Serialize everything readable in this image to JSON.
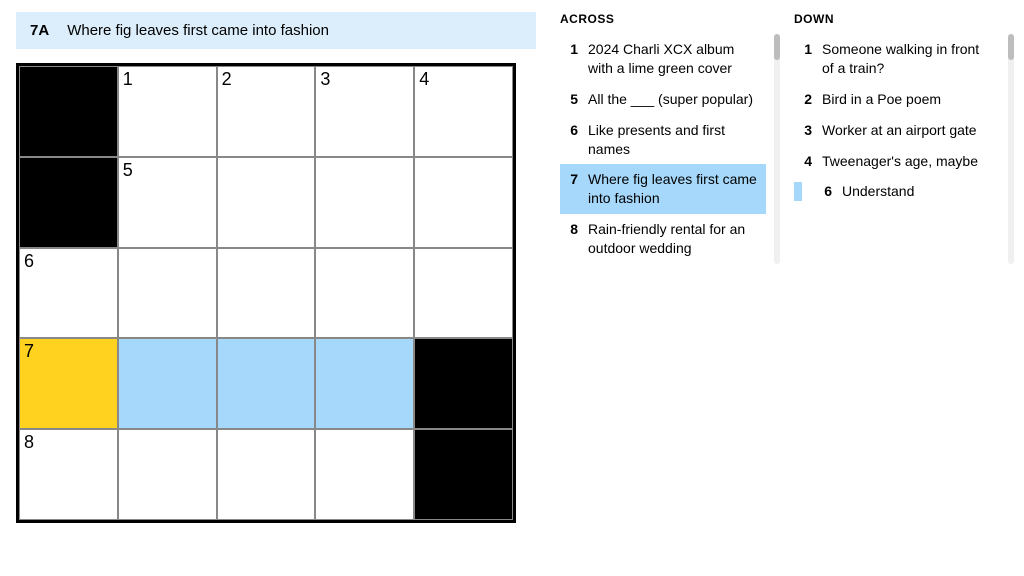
{
  "current_clue": {
    "label": "7A",
    "text": "Where fig leaves first came into fashion"
  },
  "grid": {
    "cols": 5,
    "rows": 5,
    "cells": [
      {
        "black": true
      },
      {
        "num": "1"
      },
      {
        "num": "2"
      },
      {
        "num": "3"
      },
      {
        "num": "4"
      },
      {
        "black": true
      },
      {
        "num": "5"
      },
      {},
      {},
      {},
      {
        "num": "6"
      },
      {},
      {},
      {},
      {},
      {
        "num": "7",
        "state": "active"
      },
      {
        "state": "highlight"
      },
      {
        "state": "highlight"
      },
      {
        "state": "highlight"
      },
      {
        "black": true
      },
      {
        "num": "8"
      },
      {},
      {},
      {},
      {
        "black": true
      }
    ]
  },
  "across": {
    "heading": "ACROSS",
    "clues": [
      {
        "num": "1",
        "text": "2024 Charli XCX album with a lime green cover"
      },
      {
        "num": "5",
        "text": "All the ___ (super popular)"
      },
      {
        "num": "6",
        "text": "Like presents and first names"
      },
      {
        "num": "7",
        "text": "Where fig leaves first came into fashion",
        "selected": true
      },
      {
        "num": "8",
        "text": "Rain-friendly rental for an outdoor wedding"
      }
    ]
  },
  "down": {
    "heading": "DOWN",
    "clues": [
      {
        "num": "1",
        "text": "Someone walking in front of a train?"
      },
      {
        "num": "2",
        "text": "Bird in a Poe poem"
      },
      {
        "num": "3",
        "text": "Worker at an airport gate"
      },
      {
        "num": "4",
        "text": "Tweenager's age, maybe"
      },
      {
        "num": "6",
        "text": "Understand",
        "barred": true
      }
    ]
  }
}
